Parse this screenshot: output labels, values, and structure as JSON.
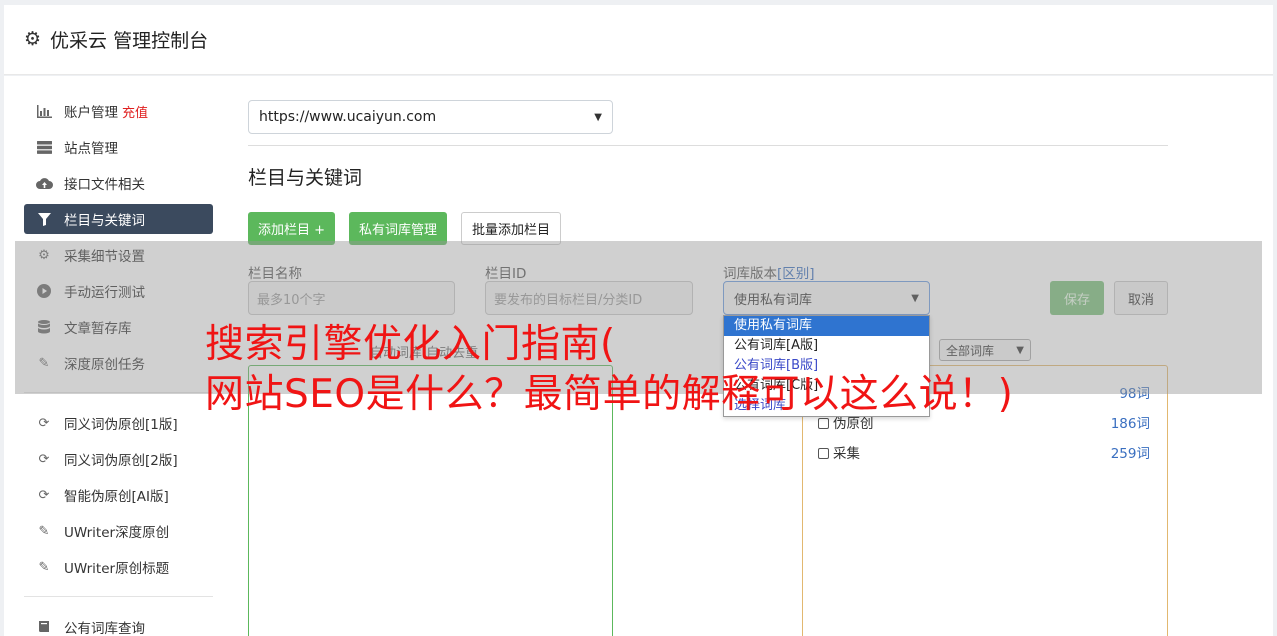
{
  "header": {
    "title": "优采云 管理控制台",
    "icon": "gear-icon"
  },
  "sidebar": {
    "items": [
      {
        "label": "账户管理",
        "tag": "充值",
        "icon": "bar-chart-icon",
        "active": false
      },
      {
        "label": "站点管理",
        "icon": "server-icon",
        "active": false
      },
      {
        "label": "接口文件相关",
        "icon": "cloud-upload-icon",
        "active": false
      },
      {
        "label": "栏目与关键词",
        "icon": "filter-icon",
        "active": true
      },
      {
        "label": "采集细节设置",
        "icon": "gears-icon",
        "active": false
      },
      {
        "label": "手动运行测试",
        "icon": "play-circle-icon",
        "active": false
      },
      {
        "label": "文章暂存库",
        "icon": "database-icon",
        "active": false
      },
      {
        "label": "深度原创任务",
        "icon": "edit-icon",
        "active": false
      }
    ],
    "items2": [
      {
        "label": "同义词伪原创[1版]",
        "icon": "refresh-icon"
      },
      {
        "label": "同义词伪原创[2版]",
        "icon": "refresh-icon"
      },
      {
        "label": "智能伪原创[AI版]",
        "icon": "refresh-icon"
      },
      {
        "label": "UWriter深度原创",
        "icon": "edit-icon"
      },
      {
        "label": "UWriter原创标题",
        "icon": "edit-icon"
      }
    ],
    "items3": [
      {
        "label": "公有词库查询",
        "icon": "book-icon"
      }
    ]
  },
  "main": {
    "site_select": "https://www.ucaiyun.com",
    "section_title": "栏目与关键词",
    "buttons": {
      "add": "添加栏目 +",
      "private": "私有词库管理",
      "batch": "批量添加栏目"
    },
    "form": {
      "name_label": "栏目名称",
      "name_placeholder": "最多10个字",
      "id_label": "栏目ID",
      "id_placeholder": "要发布的目标栏目/分类ID",
      "version_label": "词库版本",
      "version_link": "[区别]",
      "version_value": "使用私有词库",
      "save": "保存",
      "cancel": "取消"
    },
    "dropdown_options": [
      "使用私有词库",
      "公有词库[A版]",
      "公有词库[B版]",
      "公有词库[C版]",
      "选择词库"
    ],
    "hint": "自动词库 自动去重",
    "filter_select": "全部词库",
    "categories": [
      {
        "label": "",
        "count": "98词"
      },
      {
        "label": "伪原创",
        "count": "186词"
      },
      {
        "label": "采集",
        "count": "259词"
      }
    ]
  },
  "watermark": {
    "line1": "搜索引擎优化入门指南(",
    "line2": "网站SEO是什么？最简单的解释可以这么说！)"
  },
  "colors": {
    "accent_green": "#5cb85c",
    "active_nav": "#3b4a5e",
    "watermark": "#f01414"
  }
}
